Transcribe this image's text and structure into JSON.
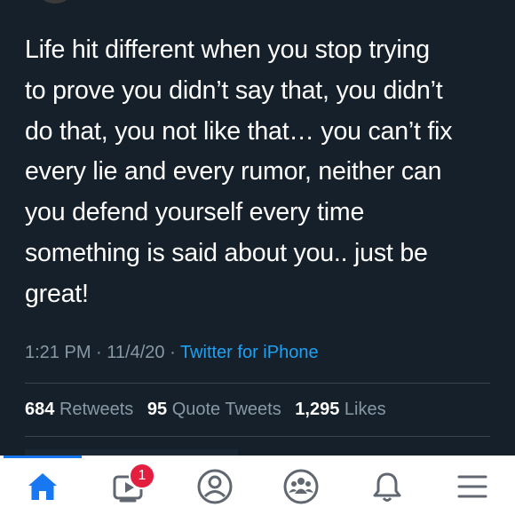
{
  "tweet": {
    "text_lines": [
      "Life hit different when you stop trying",
      "to prove you didn’t say that, you didn’t",
      "do that, you not like that… you can’t fix",
      "every lie and every rumor, neither can",
      "you defend yourself every time",
      "something is said about you.. just be",
      "great!"
    ],
    "time": "1:21 PM",
    "separator": " · ",
    "date": "11/4/20",
    "source": "Twitter for iPhone",
    "stats": {
      "retweets_count": "684",
      "retweets_label": "Retweets",
      "quote_count": "95",
      "quote_label": "Quote Tweets",
      "likes_count": "1,295",
      "likes_label": "Likes"
    }
  },
  "facebook_nav": {
    "active_tab": "home",
    "active_color": "#1877f2",
    "icon_color": "#606770",
    "items": [
      {
        "id": "home",
        "icon": "home-icon"
      },
      {
        "id": "watch",
        "icon": "watch-video-icon",
        "badge": "1"
      },
      {
        "id": "profile",
        "icon": "profile-icon"
      },
      {
        "id": "groups",
        "icon": "groups-icon"
      },
      {
        "id": "notifications",
        "icon": "bell-icon"
      },
      {
        "id": "menu",
        "icon": "menu-icon"
      }
    ]
  },
  "colors": {
    "background": "#15202b",
    "text": "#ffffff",
    "muted": "#8899a6",
    "link": "#1da1f2",
    "badge": "#e41e3f"
  }
}
